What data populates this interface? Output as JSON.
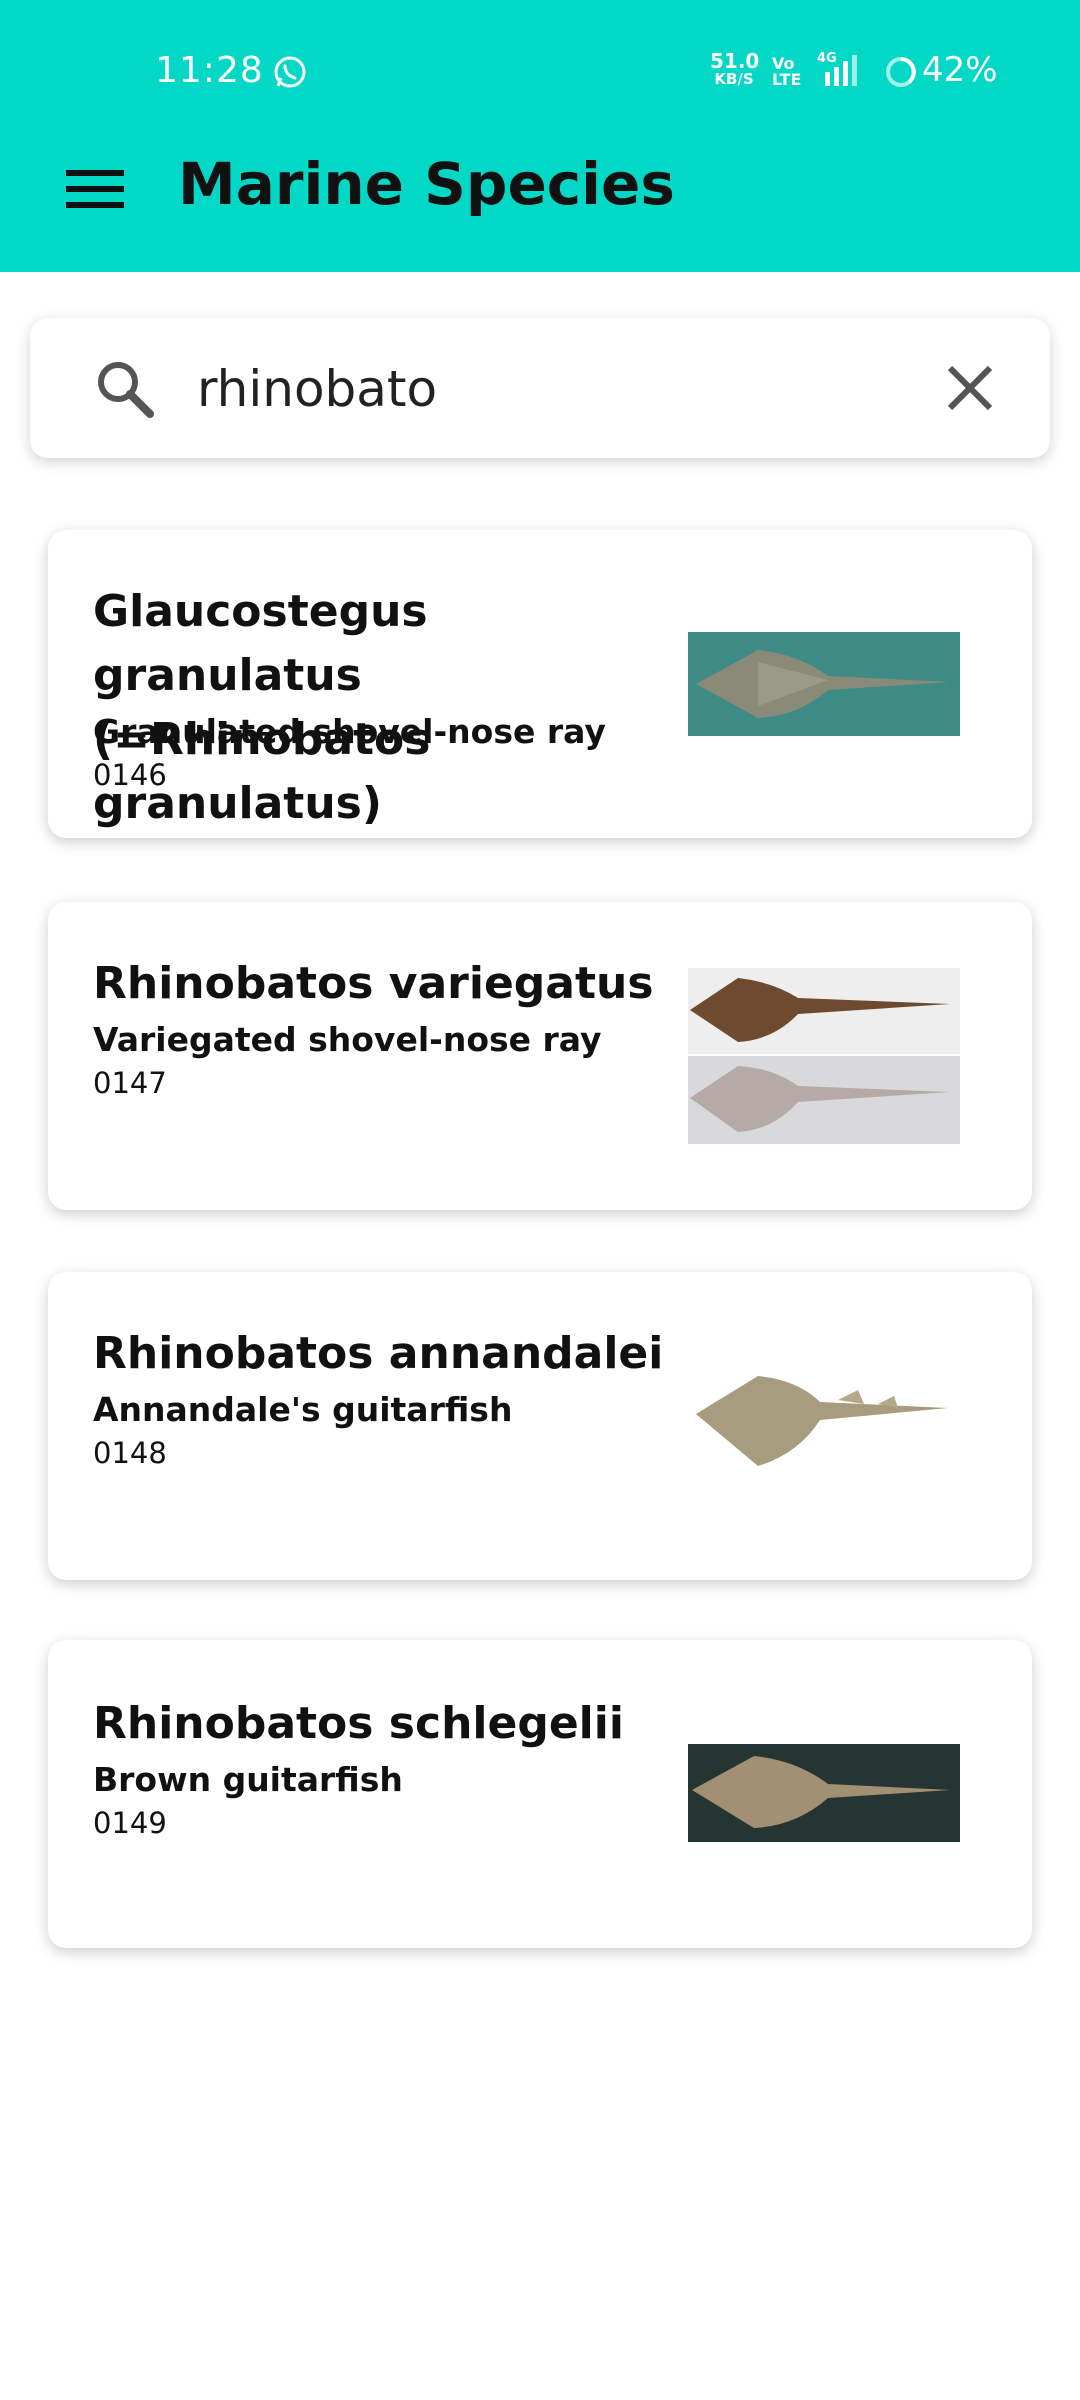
{
  "status_bar": {
    "time": "11:28",
    "net_speed": "51.0",
    "net_unit": "KB/S",
    "volte_top": "Vo",
    "volte_bottom": "LTE",
    "network": "4G",
    "battery": "42%"
  },
  "app_bar": {
    "title": "Marine Species"
  },
  "search": {
    "value": "rhinobato"
  },
  "results": [
    {
      "scientific_name": "Glaucostegus granulatus (=Rhinobatos granulatus)",
      "common_name": "Granulated shovel-nose ray",
      "code": "0146"
    },
    {
      "scientific_name": "Rhinobatos variegatus",
      "common_name": "Variegated shovel-nose ray",
      "code": "0147"
    },
    {
      "scientific_name": "Rhinobatos annandalei",
      "common_name": "Annandale's guitarfish",
      "code": "0148"
    },
    {
      "scientific_name": "Rhinobatos schlegelii",
      "common_name": "Brown guitarfish",
      "code": "0149"
    }
  ],
  "colors": {
    "accent": "#03d8c6",
    "card_bg": "#ffffff",
    "text": "#111111"
  },
  "icons": {
    "menu": "hamburger-menu-icon",
    "search": "search-icon",
    "clear": "close-icon",
    "whatsapp": "whatsapp-icon"
  }
}
